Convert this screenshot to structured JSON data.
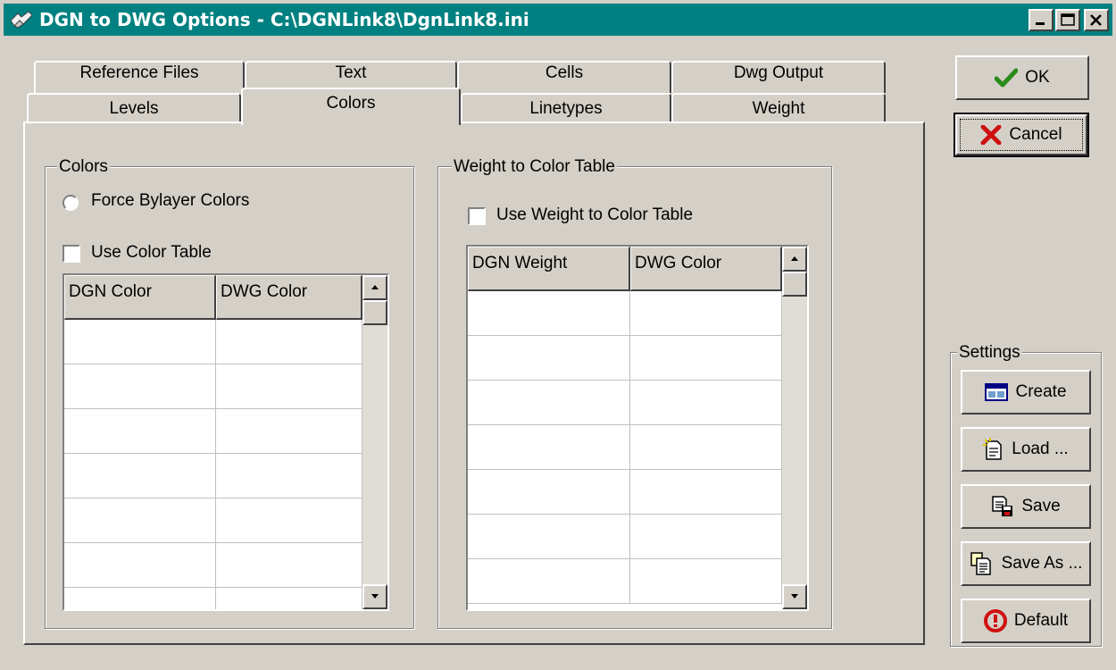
{
  "window": {
    "title": "DGN to DWG Options - C:\\DGNLink8\\DgnLink8.ini"
  },
  "tabs": {
    "row1": [
      "Reference Files",
      "Text",
      "Cells",
      "Dwg Output"
    ],
    "row2": [
      "Levels",
      "Colors",
      "Linetypes",
      "Weight"
    ],
    "selected": "Colors"
  },
  "colors_group": {
    "title": "Colors",
    "force_bylayer_label": "Force Bylayer Colors",
    "force_bylayer_selected": false,
    "use_color_table_label": "Use Color Table",
    "use_color_table_checked": false,
    "table": {
      "columns": [
        "DGN Color",
        "DWG Color"
      ]
    }
  },
  "weight_group": {
    "title": "Weight to Color Table",
    "use_weight_label": "Use Weight to Color Table",
    "use_weight_checked": false,
    "table": {
      "columns": [
        "DGN Weight",
        "DWG Color"
      ]
    }
  },
  "buttons": {
    "ok": "OK",
    "cancel": "Cancel"
  },
  "settings": {
    "title": "Settings",
    "create": "Create",
    "load": "Load ...",
    "save": "Save",
    "save_as": "Save As ...",
    "default": "Default"
  },
  "icons": {
    "app": "dgnlink-app-icon",
    "ok": "green-checkmark-icon",
    "cancel": "red-x-icon",
    "create": "window-form-icon",
    "load": "document-sparkle-icon",
    "save": "document-disk-icon",
    "save_as": "document-stack-icon",
    "default": "red-circle-exclamation-icon"
  },
  "colors_accent": {
    "titlebar": "#008080",
    "ok_check": "#2a8a1a",
    "cancel_x": "#cc1010",
    "default_icon": "#d01010"
  }
}
